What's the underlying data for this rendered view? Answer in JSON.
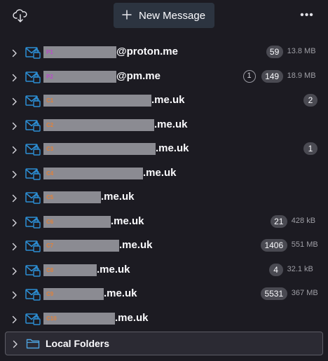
{
  "toolbar": {
    "new_message_label": "New Message",
    "more_label": "•••",
    "icons": [
      "cloud-download-icon",
      "plus-icon",
      "more-horizontal-icon"
    ]
  },
  "accounts": [
    {
      "tag": "P1",
      "tag_color": "#b84bc9",
      "domain": "@proton.me",
      "unread": "59",
      "new": "",
      "size": "13.8 MB"
    },
    {
      "tag": "P2",
      "tag_color": "#b84bc9",
      "domain": "@pm.me",
      "unread": "149",
      "new": "1",
      "size": "18.9 MB"
    },
    {
      "tag": "C1",
      "tag_color": "#e0813a",
      "domain": ".me.uk",
      "unread": "2",
      "new": "",
      "size": ""
    },
    {
      "tag": "C2",
      "tag_color": "#e0813a",
      "domain": ".me.uk",
      "unread": "",
      "new": "",
      "size": ""
    },
    {
      "tag": "C3",
      "tag_color": "#e0813a",
      "domain": ".me.uk",
      "unread": "1",
      "new": "",
      "size": ""
    },
    {
      "tag": "C4",
      "tag_color": "#e0813a",
      "domain": ".me.uk",
      "unread": "",
      "new": "",
      "size": ""
    },
    {
      "tag": "C5",
      "tag_color": "#e0813a",
      "domain": ".me.uk",
      "unread": "",
      "new": "",
      "size": ""
    },
    {
      "tag": "C6",
      "tag_color": "#e0813a",
      "domain": ".me.uk",
      "unread": "21",
      "new": "",
      "size": "428 kB"
    },
    {
      "tag": "C7",
      "tag_color": "#e0813a",
      "domain": ".me.uk",
      "unread": "1406",
      "new": "",
      "size": "551 MB"
    },
    {
      "tag": "C8",
      "tag_color": "#e0813a",
      "domain": ".me.uk",
      "unread": "4",
      "new": "",
      "size": "32.1 kB"
    },
    {
      "tag": "C9",
      "tag_color": "#e0813a",
      "domain": ".me.uk",
      "unread": "5531",
      "new": "",
      "size": "367 MB"
    },
    {
      "tag": "C10",
      "tag_color": "#e0813a",
      "domain": ".me.uk",
      "unread": "",
      "new": "",
      "size": ""
    }
  ],
  "local_folders": {
    "label": "Local Folders",
    "icon": "folder-icon"
  },
  "colors": {
    "background": "#1c1b22",
    "accent_icon": "#2d8fd5",
    "badge": "#4a4a52",
    "button": "#2c3440"
  }
}
